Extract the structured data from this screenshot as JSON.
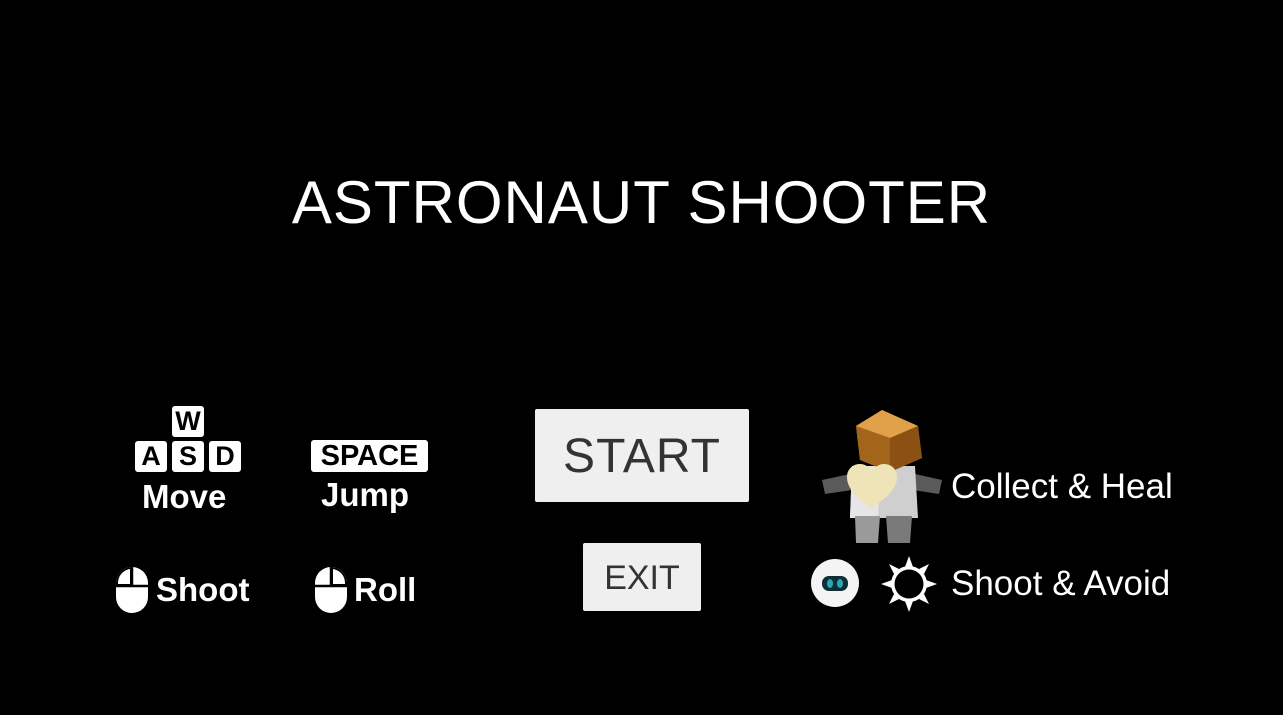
{
  "title": "ASTRONAUT SHOOTER",
  "controls": {
    "keys_wasd": [
      "W",
      "A",
      "S",
      "D"
    ],
    "move_label": "Move",
    "space_key": "SPACE",
    "jump_label": "Jump",
    "shoot_label": "Shoot",
    "roll_label": "Roll"
  },
  "menu": {
    "start_label": "START",
    "exit_label": "EXIT"
  },
  "legend": {
    "collect_text": "Collect & Heal",
    "shoot_text": "Shoot & Avoid"
  },
  "colors": {
    "background": "#000000",
    "button_bg": "#efefef",
    "button_text": "#333333",
    "heart": "#efe3b8",
    "helmet": "#b8741f",
    "enemy_eye": "#1e6a7a"
  }
}
